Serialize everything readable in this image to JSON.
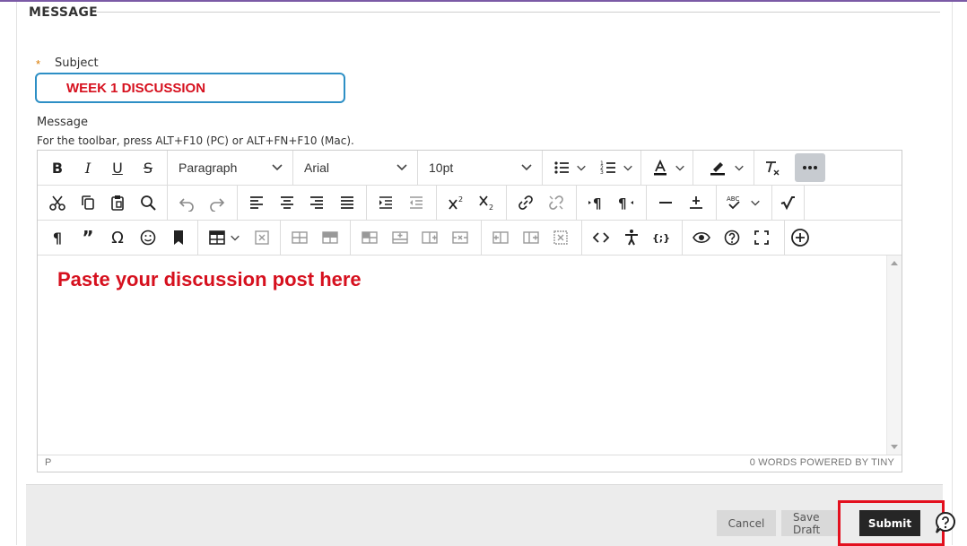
{
  "section": {
    "title": "MESSAGE"
  },
  "subject": {
    "required_marker": "*",
    "label": "Subject",
    "value": "WEEK 1 DISCUSSION"
  },
  "message": {
    "label": "Message",
    "toolbar_hint": "For the toolbar, press ALT+F10 (PC) or ALT+FN+F10 (Mac)."
  },
  "toolbar": {
    "block_format": "Paragraph",
    "font_family": "Arial",
    "font_size": "10pt"
  },
  "editor": {
    "content": "Paste your discussion post here",
    "status_path": "P",
    "status_right": "0 WORDS  POWERED BY TINY"
  },
  "footer": {
    "cancel": "Cancel",
    "save_draft": "Save Draft",
    "submit": "Submit"
  },
  "colors": {
    "accent_purple": "#7b5aa6",
    "focus_blue": "#2d8fc5",
    "annotation_red": "#e3101e",
    "submit_dark": "#262626"
  }
}
